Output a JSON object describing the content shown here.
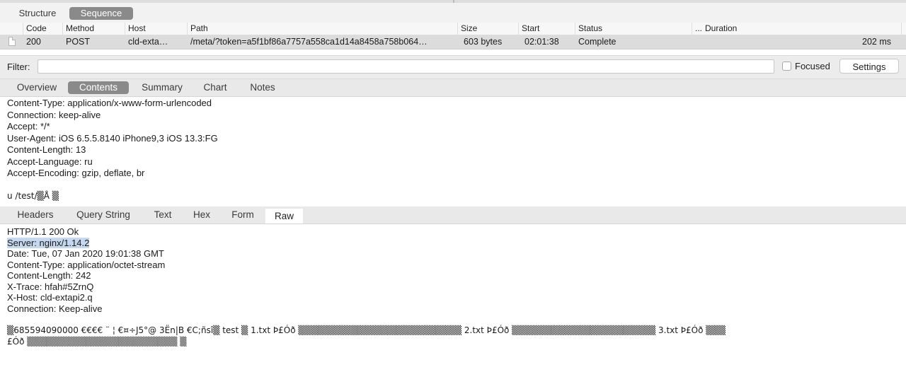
{
  "view_tabs": {
    "structure": "Structure",
    "sequence": "Sequence"
  },
  "columns": [
    "Code",
    "Method",
    "Host",
    "Path",
    "Size",
    "Start",
    "Status",
    "...",
    "Duration"
  ],
  "request_row": {
    "code": "200",
    "method": "POST",
    "host": "cld-exta…",
    "path": "/meta/?token=a5f1bf86a7757a558ca1d14a8458a758b064…",
    "size": "603 bytes",
    "start": "02:01:38",
    "status": "Complete",
    "duration": "202 ms"
  },
  "filter": {
    "label": "Filter:",
    "value": "",
    "focused_label": "Focused",
    "focused_checked": false,
    "settings_label": "Settings"
  },
  "detail_tabs": {
    "overview": "Overview",
    "contents": "Contents",
    "summary": "Summary",
    "chart": "Chart",
    "notes": "Notes"
  },
  "request_lines": [
    "Content-Type: application/x-www-form-urlencoded",
    "Connection: keep-alive",
    "Accept: */*",
    "User-Agent: iOS 6.5.5.8140 iPhone9,3 iOS 13.3:FG",
    "Content-Length: 13",
    "Accept-Language: ru",
    "Accept-Encoding: gzip, deflate, br"
  ],
  "request_body": "u /test/▒Å ▒",
  "response_tabs": {
    "headers": "Headers",
    "query_string": "Query String",
    "text": "Text",
    "hex": "Hex",
    "form": "Form",
    "raw": "Raw"
  },
  "response_lines": [
    "HTTP/1.1 200 Ok",
    "Server: nginx/1.14.2",
    "Date: Tue, 07 Jan 2020 19:01:38 GMT",
    "Content-Type: application/octet-stream",
    "Content-Length: 242",
    "X-Trace: hfah#5ZrnQ",
    "X-Host: cld-extapi2.q",
    "Connection: Keep-alive"
  ],
  "response_body_line1": "▒685594090000 €€€€   ¨   ¦ €¤÷J5°@   3Ën|B    €C;ñsî▒ test  ▒ 1.txt Þ£Óð ▒▒▒▒▒▒▒▒▒▒▒▒▒▒▒▒▒▒▒▒▒▒▒▒▒ 2.txt Þ£Óð ▒▒▒▒▒▒▒▒▒▒▒▒▒▒▒▒▒▒▒▒▒▒ 3.txt Þ£Óð ▒▒▒",
  "response_body_line2": "£Óð ▒▒▒▒▒▒▒▒▒▒▒▒▒▒▒▒▒▒▒▒▒▒▒ ▒",
  "colors": {
    "active_tab": "#8a8a8a",
    "row_selected": "#dcdcdc",
    "highlight": "#c5d8ef"
  }
}
